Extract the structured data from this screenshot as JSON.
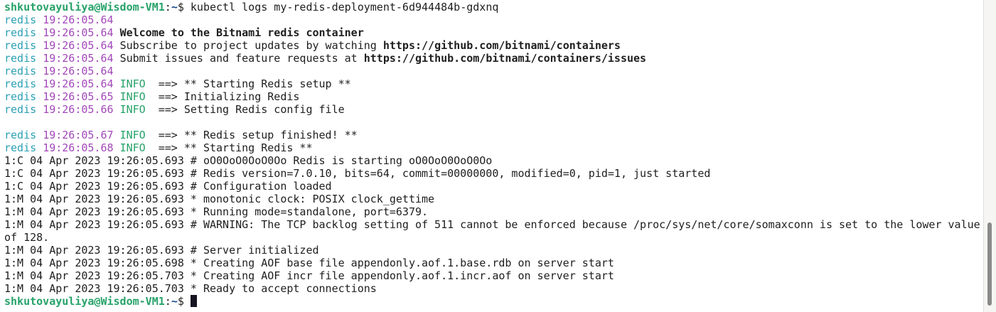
{
  "prompt": {
    "user_host": "shkutovayuliya@Wisdom-VM1",
    "sep": ":",
    "path": "~",
    "symbol": "$",
    "command": " kubectl logs my-redis-deployment-6d944484b-gdxnq"
  },
  "app_lines": [
    {
      "prog": "redis",
      "ts": "19:26:05.64",
      "level": "",
      "msg": "",
      "bold": ""
    },
    {
      "prog": "redis",
      "ts": "19:26:05.64",
      "level": "",
      "msg": "",
      "bold": "Welcome to the Bitnami redis container"
    },
    {
      "prog": "redis",
      "ts": "19:26:05.64",
      "level": "",
      "msg": "Subscribe to project updates by watching ",
      "bold": "https://github.com/bitnami/containers"
    },
    {
      "prog": "redis",
      "ts": "19:26:05.64",
      "level": "",
      "msg": "Submit issues and feature requests at ",
      "bold": "https://github.com/bitnami/containers/issues"
    },
    {
      "prog": "redis",
      "ts": "19:26:05.64",
      "level": "",
      "msg": "",
      "bold": ""
    },
    {
      "prog": "redis",
      "ts": "19:26:05.64",
      "level": "INFO ",
      "msg": " ==> ** Starting Redis setup **",
      "bold": ""
    },
    {
      "prog": "redis",
      "ts": "19:26:05.65",
      "level": "INFO ",
      "msg": " ==> Initializing Redis",
      "bold": ""
    },
    {
      "prog": "redis",
      "ts": "19:26:05.66",
      "level": "INFO ",
      "msg": " ==> Setting Redis config file",
      "bold": ""
    },
    {
      "prog": "",
      "ts": "",
      "level": "",
      "msg": "",
      "bold": ""
    },
    {
      "prog": "redis",
      "ts": "19:26:05.67",
      "level": "INFO ",
      "msg": " ==> ** Redis setup finished! **",
      "bold": ""
    },
    {
      "prog": "redis",
      "ts": "19:26:05.68",
      "level": "INFO ",
      "msg": " ==> ** Starting Redis **",
      "bold": ""
    }
  ],
  "redis_lines": [
    "1:C 04 Apr 2023 19:26:05.693 # oO0OoO0OoO0Oo Redis is starting oO0OoO0OoO0Oo",
    "1:C 04 Apr 2023 19:26:05.693 # Redis version=7.0.10, bits=64, commit=00000000, modified=0, pid=1, just started",
    "1:C 04 Apr 2023 19:26:05.693 # Configuration loaded",
    "1:M 04 Apr 2023 19:26:05.693 * monotonic clock: POSIX clock_gettime",
    "1:M 04 Apr 2023 19:26:05.693 * Running mode=standalone, port=6379.",
    "1:M 04 Apr 2023 19:26:05.693 # WARNING: The TCP backlog setting of 511 cannot be enforced because /proc/sys/net/core/somaxconn is set to the lower value",
    "of 128.",
    "1:M 04 Apr 2023 19:26:05.693 # Server initialized",
    "1:M 04 Apr 2023 19:26:05.698 * Creating AOF base file appendonly.aof.1.base.rdb on server start",
    "1:M 04 Apr 2023 19:26:05.703 * Creating AOF incr file appendonly.aof.1.incr.aof on server start",
    "1:M 04 Apr 2023 19:26:05.703 * Ready to accept connections"
  ],
  "colors": {
    "prompt_user": "#26a269",
    "prompt_path": "#12488b",
    "program": "#2a9fb5",
    "timestamp": "#a347ba",
    "level": "#26a269"
  }
}
